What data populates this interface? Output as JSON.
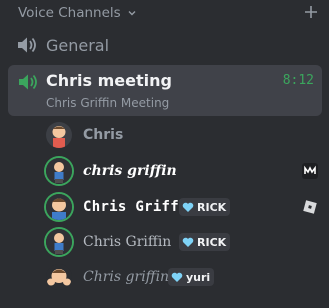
{
  "header": {
    "title": "Voice Channels"
  },
  "channels": [
    {
      "name": "General"
    },
    {
      "name": "Chris meeting",
      "timer": "8:12",
      "subtitle": "Chris Griffin Meeting"
    }
  ],
  "members": [
    {
      "name": "Chris",
      "speaking": false
    },
    {
      "name": "chris griffin",
      "speaking": true,
      "activity_icon": "rpc-app-icon"
    },
    {
      "name": "Chris Griffin",
      "speaking": true,
      "tag": "RICK",
      "activity_icon": "roblox-icon"
    },
    {
      "name": "Chris Griffin",
      "speaking": true,
      "tag": "RICK"
    },
    {
      "name": "Chris griffin",
      "speaking": false,
      "tag": "yuri"
    }
  ],
  "colors": {
    "background": "#2b2d31",
    "active_channel_bg": "#404249",
    "speaking_green": "#3ba55d",
    "muted_text": "#949ba4"
  }
}
